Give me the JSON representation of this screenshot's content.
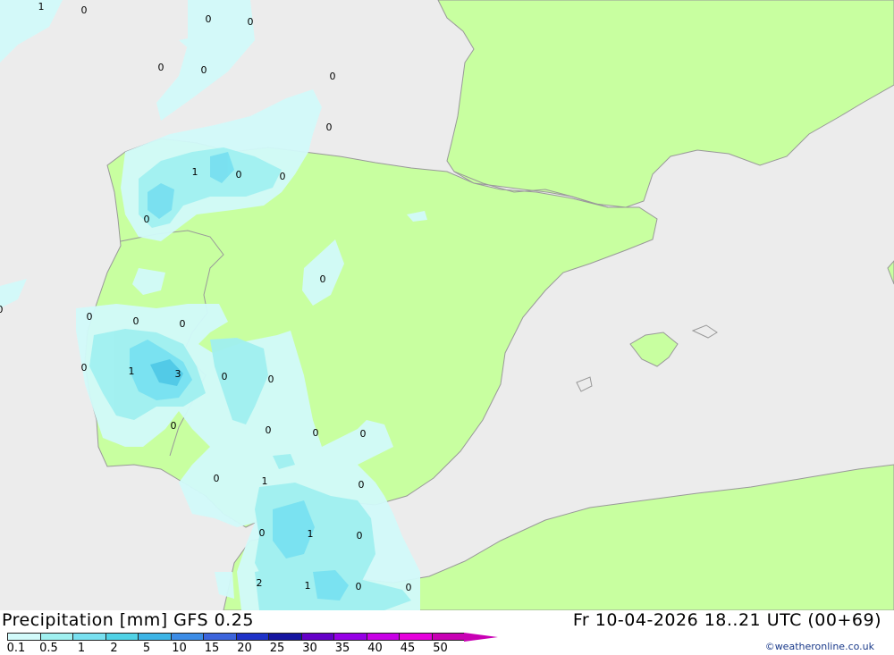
{
  "title": "Precipitation [mm]  GFS 0.25",
  "datetime": "Fr 10-04-2026 18..21 UTC (00+69)",
  "credit": "©weatheronline.co.uk",
  "colors": {
    "sea": "#ececec",
    "land": "#c8ffa0",
    "precip_light": "#d2fafa",
    "precip_mid": "#a0f0f0",
    "precip_strong": "#78e0f0",
    "precip_heavy": "#50c8e6"
  },
  "legend": {
    "ticks": [
      "0.1",
      "0.5",
      "1",
      "2",
      "5",
      "10",
      "15",
      "20",
      "25",
      "30",
      "35",
      "40",
      "45",
      "50"
    ],
    "colors": [
      "#d2fafa",
      "#a0f0f0",
      "#78e0f0",
      "#50d2e6",
      "#3cb4e6",
      "#3c8ce6",
      "#3c64dc",
      "#1e32c8",
      "#1414a0",
      "#6400c8",
      "#9600e6",
      "#c800e6",
      "#e600dc",
      "#c800b4"
    ]
  },
  "value_labels": [
    {
      "id": "lbl-01",
      "text": "1"
    },
    {
      "id": "lbl-02",
      "text": "0"
    },
    {
      "id": "lbl-03",
      "text": "0"
    },
    {
      "id": "lbl-04",
      "text": "0"
    },
    {
      "id": "lbl-05",
      "text": "0"
    },
    {
      "id": "lbl-06",
      "text": "0"
    },
    {
      "id": "lbl-07",
      "text": "0"
    },
    {
      "id": "lbl-08",
      "text": "0"
    },
    {
      "id": "lbl-09",
      "text": "1"
    },
    {
      "id": "lbl-10",
      "text": "0"
    },
    {
      "id": "lbl-11",
      "text": "0"
    },
    {
      "id": "lbl-12",
      "text": "0"
    },
    {
      "id": "lbl-13",
      "text": "0"
    },
    {
      "id": "lbl-14",
      "text": "0"
    },
    {
      "id": "lbl-15",
      "text": "0"
    },
    {
      "id": "lbl-16",
      "text": "0"
    },
    {
      "id": "lbl-17",
      "text": "0"
    },
    {
      "id": "lbl-18",
      "text": "1"
    },
    {
      "id": "lbl-19",
      "text": "3"
    },
    {
      "id": "lbl-20",
      "text": "0"
    },
    {
      "id": "lbl-21",
      "text": "0"
    },
    {
      "id": "lbl-22",
      "text": "0"
    },
    {
      "id": "lbl-23",
      "text": "0"
    },
    {
      "id": "lbl-24",
      "text": "0"
    },
    {
      "id": "lbl-25",
      "text": "0"
    },
    {
      "id": "lbl-26",
      "text": "0"
    },
    {
      "id": "lbl-27",
      "text": "1"
    },
    {
      "id": "lbl-28",
      "text": "0"
    },
    {
      "id": "lbl-29",
      "text": "0"
    },
    {
      "id": "lbl-30",
      "text": "1"
    },
    {
      "id": "lbl-31",
      "text": "0"
    },
    {
      "id": "lbl-32",
      "text": "2"
    },
    {
      "id": "lbl-33",
      "text": "1"
    },
    {
      "id": "lbl-34",
      "text": "0"
    },
    {
      "id": "lbl-35",
      "text": "0"
    }
  ]
}
